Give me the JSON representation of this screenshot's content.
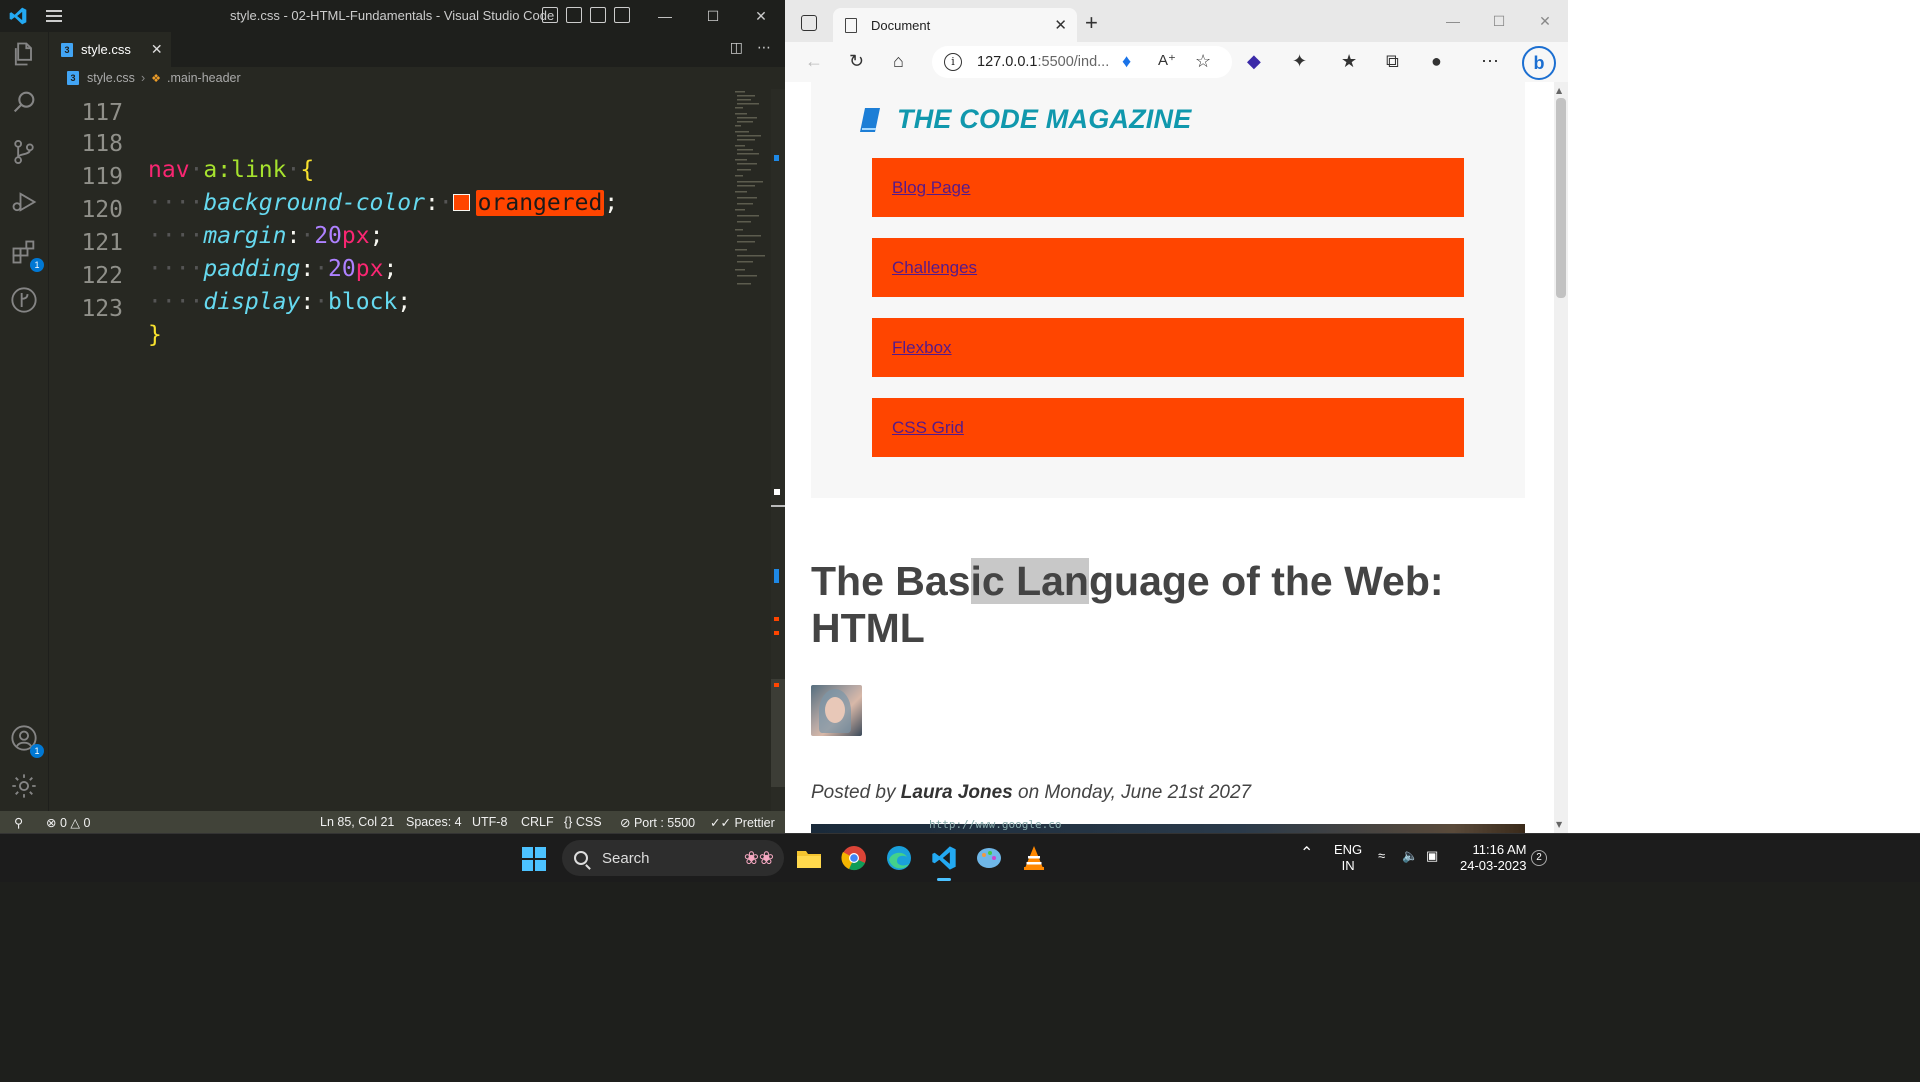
{
  "vscode": {
    "title": "style.css - 02-HTML-Fundamentals - Visual Studio Code",
    "tab": {
      "label": "style.css",
      "icon_letter": "3"
    },
    "breadcrumb": {
      "file": "style.css",
      "symbol": ".main-header"
    },
    "code": {
      "partial_line_number": "117",
      "lines": [
        {
          "num": "118",
          "selector": "nav",
          "pseudo": "a:link",
          "brace": "{"
        },
        {
          "num": "119",
          "prop": "background-color",
          "value": "orangered"
        },
        {
          "num": "120",
          "prop": "margin",
          "num_val": "20",
          "unit": "px"
        },
        {
          "num": "121",
          "prop": "padding",
          "num_val": "20",
          "unit": "px"
        },
        {
          "num": "122",
          "prop": "display",
          "value": "block"
        },
        {
          "num": "123",
          "brace": "}"
        }
      ]
    },
    "activity_badges": {
      "extensions": "1",
      "accounts": "1"
    },
    "status": {
      "errors": "0",
      "warnings": "0",
      "cursor": "Ln 85, Col 21",
      "spaces": "Spaces: 4",
      "encoding": "UTF-8",
      "eol": "CRLF",
      "language": "CSS",
      "port": "Port : 5500",
      "formatter": "Prettier"
    }
  },
  "edge": {
    "tab_title": "Document",
    "url_host": "127.0.0.1",
    "url_path": ":5500/ind...",
    "page": {
      "brand": "THE CODE MAGAZINE",
      "nav_links": [
        "Blog Page",
        "Challenges",
        "Flexbox",
        "CSS Grid"
      ],
      "title_pre": "The Bas",
      "title_highlight": "ic Lan",
      "title_post": "guage of the Web: HTML",
      "byline_prefix": "Posted by ",
      "author": "Laura Jones",
      "byline_suffix": " on Monday, June 21st 2027",
      "img_caption_text": "http://www.google.co"
    }
  },
  "taskbar": {
    "search_label": "Search",
    "lang_top": "ENG",
    "lang_bottom": "IN",
    "time": "11:16 AM",
    "date": "24-03-2023",
    "notification_count": "2"
  },
  "colors": {
    "orangered": "#ff4500",
    "brand": "#1098ad",
    "vscode_bg": "#272822",
    "status_bg": "#414339"
  }
}
